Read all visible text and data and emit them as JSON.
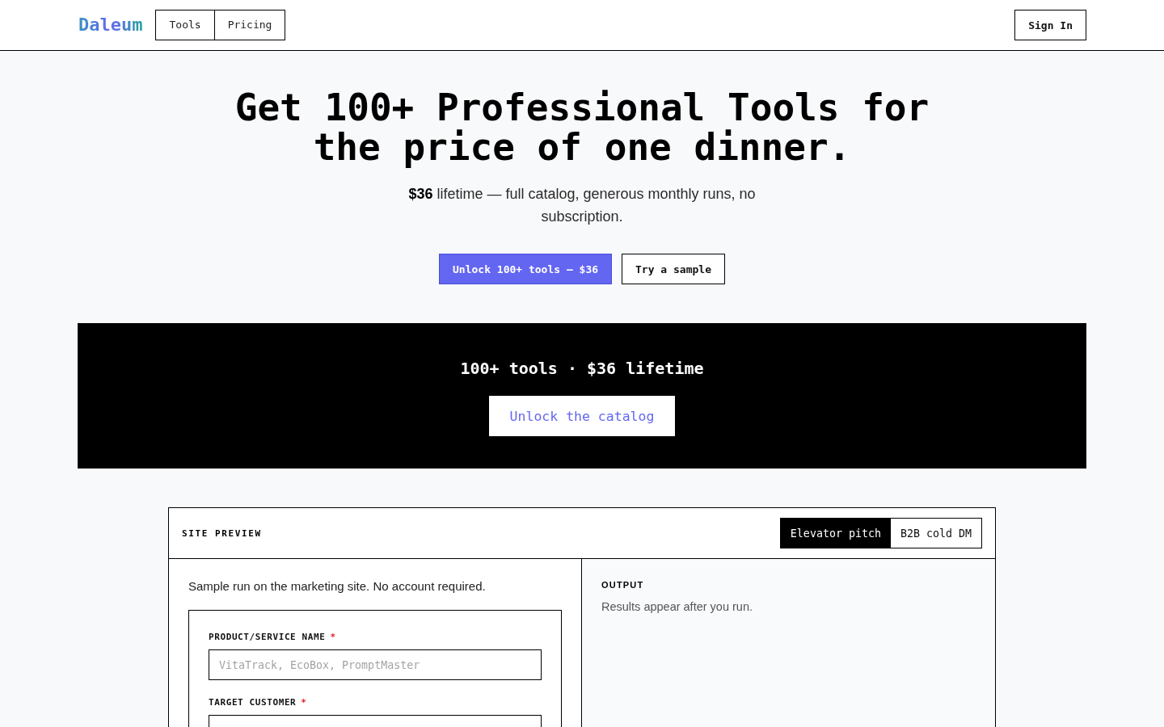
{
  "nav": {
    "logo": "Daleum",
    "links": [
      {
        "label": "Tools"
      },
      {
        "label": "Pricing"
      }
    ],
    "sign_in": "Sign In"
  },
  "hero": {
    "title": "Get 100+ Professional Tools for the price of one dinner.",
    "subtitle": "**$36** lifetime — full catalog, generous monthly runs, no subscription.",
    "buttons": [
      {
        "label": "Unlock 100+ tools — $36",
        "kind": "primary"
      },
      {
        "label": "Try a sample",
        "kind": "secondary"
      }
    ]
  },
  "banner": {
    "headline": "100+ tools · $36 lifetime",
    "button": "Unlock the catalog"
  },
  "preview": {
    "title": "SITE PREVIEW",
    "tabs": [
      {
        "label": "Elevator pitch",
        "selected": true
      },
      {
        "label": "B2B cold DM",
        "selected": false
      }
    ],
    "note": "Sample run on the marketing site. No account required.",
    "fields": [
      {
        "label": "PRODUCT/SERVICE NAME",
        "required_mark": "*",
        "placeholder": "VitaTrack, EcoBox, PromptMaster"
      },
      {
        "label": "TARGET CUSTOMER",
        "required_mark": "*"
      }
    ],
    "output": {
      "title": "OUTPUT",
      "text": "Results appear after you run."
    }
  }
}
